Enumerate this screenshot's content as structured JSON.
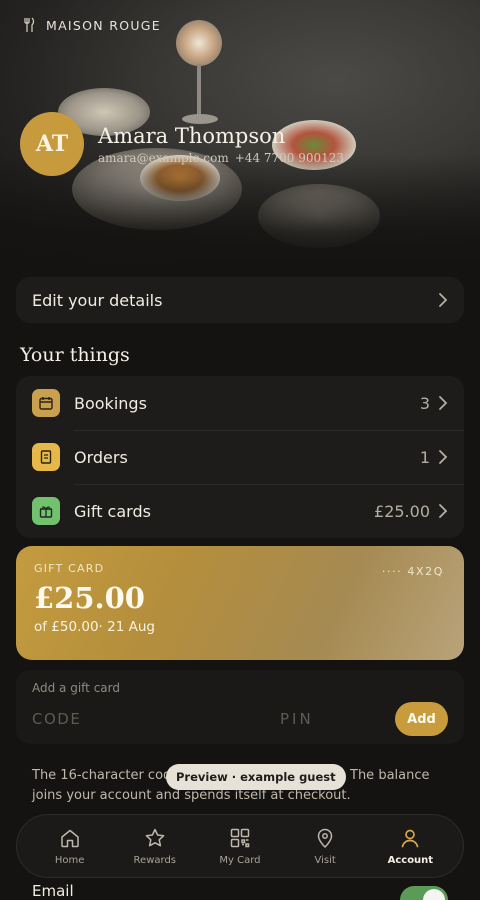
{
  "brand": {
    "name": "MAISON ROUGE",
    "logo_icon": "fork-knife-monogram-icon"
  },
  "profile": {
    "initials": "AT",
    "name": "Amara Thompson",
    "email": "amara@example.com",
    "phone": "+44 7700 900123"
  },
  "edit_details": {
    "label": "Edit your details"
  },
  "your_things": {
    "title": "Your things",
    "items": [
      {
        "label": "Bookings",
        "value": "3",
        "icon": "calendar-icon",
        "color": "#c9a04d"
      },
      {
        "label": "Orders",
        "value": "1",
        "icon": "receipt-icon",
        "color": "#e6b84a"
      },
      {
        "label": "Gift cards",
        "value": "£25.00",
        "icon": "gift-icon",
        "color": "#72c16e"
      }
    ]
  },
  "gift_card": {
    "kicker": "GIFT CARD",
    "code_dots": "····",
    "code_suffix": "4X2Q",
    "amount": "£25.00",
    "of_total": "of £50.00",
    "expiry": "· 21 Aug"
  },
  "add_gift_card": {
    "title": "Add a gift card",
    "code_placeholder": "CODE",
    "pin_placeholder": "PIN",
    "button": "Add"
  },
  "help_text": "The 16-character code is in your gift-card email. The balance joins your account and spends itself at checkout.",
  "preview_badge": "Preview · example guest",
  "tabs": [
    {
      "label": "Home",
      "icon": "home-icon",
      "active": false
    },
    {
      "label": "Rewards",
      "icon": "star-icon",
      "active": false
    },
    {
      "label": "My Card",
      "icon": "qr-code-icon",
      "active": false
    },
    {
      "label": "Visit",
      "icon": "map-pin-icon",
      "active": false
    },
    {
      "label": "Account",
      "icon": "user-icon",
      "active": true
    }
  ],
  "preferences": {
    "email_label": "Email",
    "email_enabled": true
  },
  "colors": {
    "accent": "#c89b3c",
    "background": "#141311",
    "card": "#1d1c1a",
    "toggle_on": "#5a9b58"
  }
}
